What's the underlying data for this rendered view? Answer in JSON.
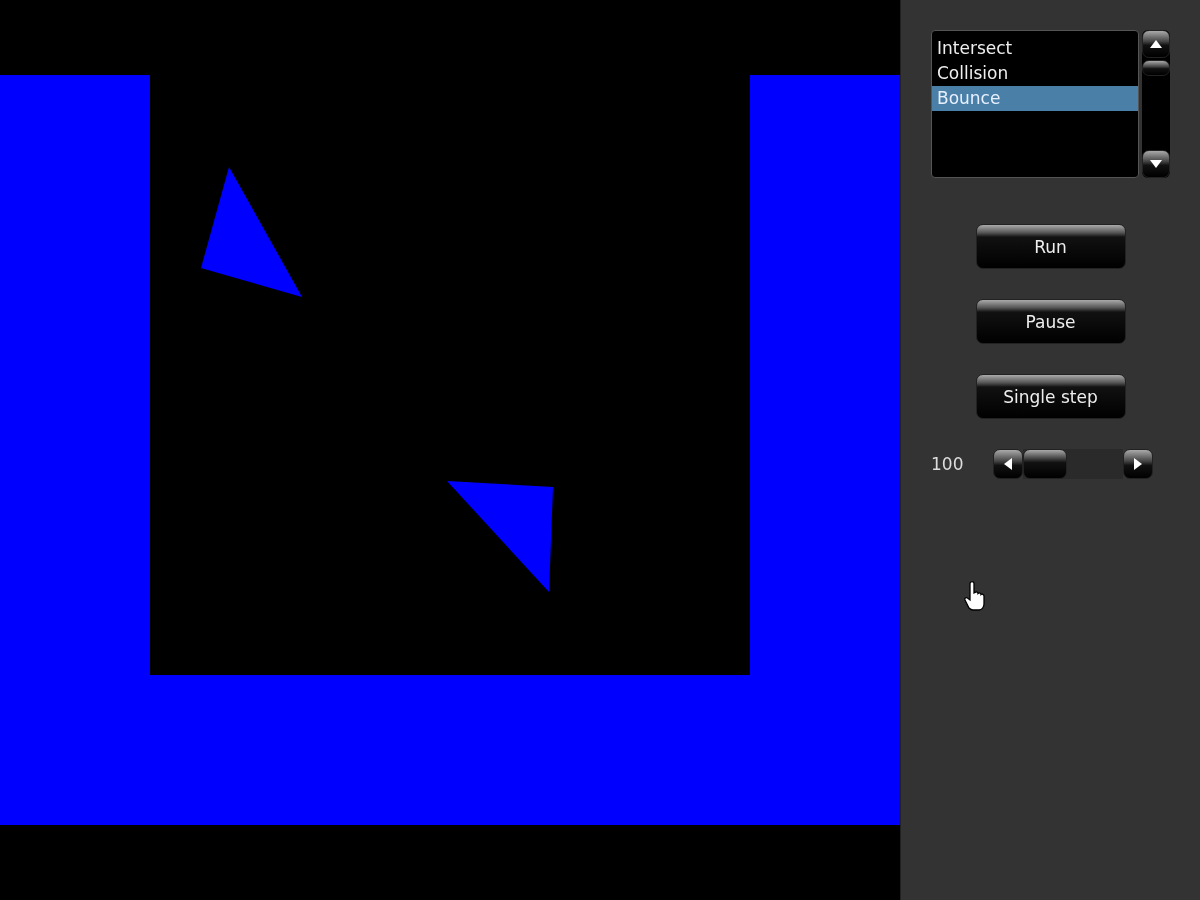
{
  "scene_list": {
    "items": [
      {
        "label": "Intersect",
        "selected": false
      },
      {
        "label": "Collision",
        "selected": false
      },
      {
        "label": "Bounce",
        "selected": true
      }
    ]
  },
  "buttons": [
    "Run",
    "Pause",
    "Single step"
  ],
  "speed": {
    "reading": "100",
    "level": 0
  }
}
